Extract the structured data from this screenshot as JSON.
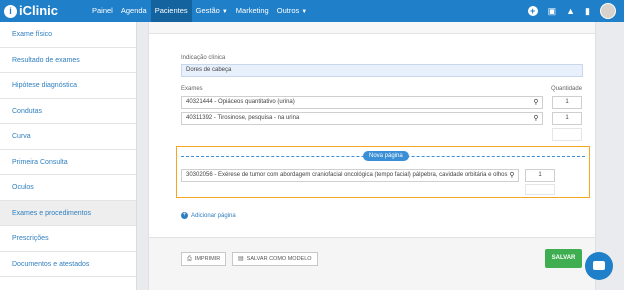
{
  "app": {
    "logo_letter": "i",
    "name": "iClinic"
  },
  "nav": {
    "items": [
      {
        "label": "Painel"
      },
      {
        "label": "Agenda"
      },
      {
        "label": "Pacientes"
      },
      {
        "label": "Gestão"
      },
      {
        "label": "Marketing"
      },
      {
        "label": "Outros"
      }
    ],
    "active": "Pacientes",
    "icons": [
      "plus-icon",
      "gift-icon",
      "bell-icon",
      "chat-icon",
      "avatar"
    ]
  },
  "sidebar": {
    "items": [
      {
        "label": "Exame físico"
      },
      {
        "label": "Resultado de exames"
      },
      {
        "label": "Hipótese diagnóstica"
      },
      {
        "label": "Condutas"
      },
      {
        "label": "Curva"
      },
      {
        "label": "Primeira Consulta"
      },
      {
        "label": "Oculos"
      },
      {
        "label": "Exames e procedimentos"
      },
      {
        "label": "Prescrições"
      },
      {
        "label": "Documentos e atestados"
      }
    ],
    "active": "Exames e procedimentos"
  },
  "form": {
    "indicacao_label": "Indicação clínica",
    "indicacao_value": "Dores de cabeça",
    "exames_label": "Exames",
    "quantidade_label": "Quantidade",
    "rows": [
      {
        "exam": "40321444 - Opiáceos quantitativo (urina)",
        "qty": "1"
      },
      {
        "exam": "40311392 - Tirosinose, pesquisa - na urina",
        "qty": "1"
      }
    ],
    "new_page_label": "Nova página",
    "new_page_row": {
      "exam": "30302056 - Exérese de tumor com abordagem craniofacial oncológica (tempo facial) pálpebra, cavidade orbitária e olhos",
      "qty": "1"
    },
    "add_page_label": "Adicionar página"
  },
  "buttons": {
    "print": "IMPRIMIR",
    "save_model": "SALVAR COMO MODELO",
    "save": "SALVAR"
  },
  "colors": {
    "primary": "#1f7fc8",
    "highlight": "#f5a623",
    "save": "#3fae50"
  }
}
